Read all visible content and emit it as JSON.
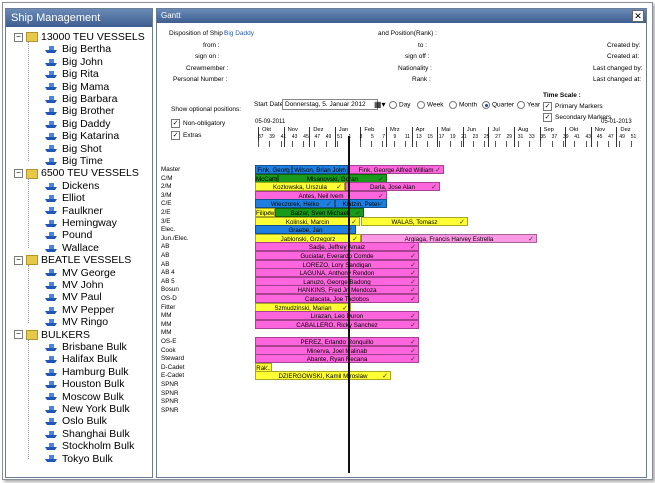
{
  "left_panel": {
    "title": "Ship Management",
    "groups": [
      {
        "label": "13000 TEU VESSELS",
        "items": [
          "Big Bertha",
          "Big John",
          "Big Rita",
          "Big  Mama",
          "Big Barbara",
          "Big Brother",
          "Big Daddy",
          "Big Katarina",
          "Big Shot",
          "Big Time"
        ]
      },
      {
        "label": "6500 TEU VESSELS",
        "items": [
          "Dickens",
          "Elliot",
          "Faulkner",
          "Hemingway",
          "Pound",
          "Wallace"
        ]
      },
      {
        "label": "BEATLE VESSELS",
        "items": [
          "MV George",
          "MV John",
          "MV Paul",
          "MV Pepper",
          "MV Ringo"
        ]
      },
      {
        "label": "BULKERS",
        "items": [
          "Brisbane Bulk",
          "Halifax Bulk",
          "Hamburg Bulk",
          "Houston Bulk",
          "Moscow Bulk",
          "New York Bulk",
          "Oslo Bulk",
          "Shanghai Bulk",
          "Stockholm Bulk",
          "Tokyo Bulk"
        ]
      }
    ]
  },
  "gantt": {
    "title": "Gantt",
    "info": {
      "disposition_label": "Disposition of Ship :",
      "disposition_value": "Big Daddy",
      "from_label": "from :",
      "signon_label": "sign on :",
      "crewmember_label": "Crewmember :",
      "personal_label": "Personal Number :",
      "position_label": "and Position(Rank) :",
      "to_label": "to :",
      "signoff_label": "sign off :",
      "nationality_label": "Nationality :",
      "rank_label": "Rank :",
      "created_by": "Created by:",
      "created_at": "Created at:",
      "last_changed_by": "Last changed by:",
      "last_changed_at": "Last changed at:"
    },
    "options": {
      "show_label": "Show optional positions:",
      "non_obligatory": "Non-obligatory",
      "extras": "Extras"
    },
    "controls": {
      "start_date_label": "Start Date:",
      "start_date_value": "Donnerstag,  5.  Januar  2012",
      "day": "Day",
      "week": "Week",
      "month": "Month",
      "quarter": "Quarter",
      "year": "Year",
      "selected_scale": "Quarter",
      "time_scale_label": "Time Scale :",
      "primary_markers": "Primary Markers",
      "secondary_markers": "Secondary Markers"
    },
    "axis": {
      "start_date": "05-09-2011",
      "end_date": "05-01-2013",
      "months": [
        "Okt",
        "Nov",
        "Dez",
        "Jan",
        "Feb",
        "Mrz",
        "Apr",
        "Mai",
        "Jun",
        "Jul",
        "Aug",
        "Sep",
        "Okt",
        "Nov",
        "Dez"
      ],
      "weeks": [
        "37",
        "39",
        "41",
        "43",
        "45",
        "47",
        "49",
        "51",
        "1",
        "3",
        "5",
        "7",
        "9",
        "11",
        "13",
        "15",
        "17",
        "19",
        "21",
        "23",
        "25",
        "27",
        "29",
        "31",
        "33",
        "35",
        "37",
        "39",
        "41",
        "43",
        "45",
        "47",
        "49",
        "51"
      ]
    },
    "rows": [
      {
        "role": "Master",
        "bars": [
          {
            "text": "Fink, Georg",
            "color": "#1e7fe0"
          },
          {
            "text": "Wilson, Brian John",
            "color": "#1e7fe0"
          },
          {
            "text": "Fink, George Alfred William",
            "color": "#ff66dd"
          }
        ]
      },
      {
        "role": "C/M",
        "bars": [
          {
            "text": "McCartr...",
            "color": "#1a9a1a"
          },
          {
            "text": "Mlsanovski, Goran",
            "color": "#1a9a1a"
          }
        ]
      },
      {
        "role": "2/M",
        "bars": [
          {
            "text": "Kozlowska, Urszula",
            "color": "#ffff33"
          },
          {
            "text": "Darla, Jose Alan",
            "color": "#ff66dd"
          }
        ]
      },
      {
        "role": "3/M",
        "bars": [
          {
            "text": "Antes, Neil Ivem",
            "color": "#ff66dd"
          }
        ]
      },
      {
        "role": "C/E",
        "bars": [
          {
            "text": "Wieczorek, Heiko",
            "color": "#1e7fe0"
          },
          {
            "text": "Klatzin, Peter",
            "color": "#1e7fe0"
          }
        ]
      },
      {
        "role": "2/E",
        "bars": [
          {
            "text": "Filipow...",
            "color": "#ffff33"
          },
          {
            "text": "Balzer, Sven Michael",
            "color": "#1a9a1a"
          }
        ]
      },
      {
        "role": "3/E",
        "bars": [
          {
            "text": "Kolinski, Marcin",
            "color": "#ffff33"
          },
          {
            "text": "WALAS, Tomasz",
            "color": "#ffff33"
          }
        ]
      },
      {
        "role": "Elec.",
        "bars": [
          {
            "text": "Graebe, Jan",
            "color": "#1e7fe0"
          }
        ]
      },
      {
        "role": "Jun./Elec.",
        "bars": [
          {
            "text": "Jablonski, Grzegorz",
            "color": "#ffff33"
          },
          {
            "text": "Argiaga, Francis Harvey Estrella",
            "color": "#ff99e6"
          }
        ]
      },
      {
        "role": "AB",
        "bars": [
          {
            "text": "Sadje, Jeffrey Amaiz",
            "color": "#ff66dd"
          }
        ]
      },
      {
        "role": "AB",
        "bars": [
          {
            "text": "Guciatar, Everardo Comde",
            "color": "#ff66dd"
          }
        ]
      },
      {
        "role": "AB",
        "bars": [
          {
            "text": "LOREZO, Lory Sandigan",
            "color": "#ff66dd"
          }
        ]
      },
      {
        "role": "AB 4",
        "bars": [
          {
            "text": "LAGUNA, Anthony Rendon",
            "color": "#ff66dd"
          }
        ]
      },
      {
        "role": "AB 5",
        "bars": [
          {
            "text": "Lanuzo, George Badong",
            "color": "#ff66dd"
          }
        ]
      },
      {
        "role": "Bosun",
        "bars": [
          {
            "text": "HANKINS, Fred Jr. Mendoza",
            "color": "#ff66dd"
          }
        ]
      },
      {
        "role": "OS-D",
        "bars": [
          {
            "text": "Catacata, Joe Taclobos",
            "color": "#ff66dd"
          }
        ]
      },
      {
        "role": "Fitter",
        "bars": [
          {
            "text": "Szmudzinski, Marian",
            "color": "#ffff33"
          }
        ]
      },
      {
        "role": "MM",
        "bars": [
          {
            "text": "Lirazan, Leo Duron",
            "color": "#ff66dd"
          }
        ]
      },
      {
        "role": "MM",
        "bars": [
          {
            "text": "CABALLERO, Ricky Sanchez",
            "color": "#ff66dd"
          }
        ]
      },
      {
        "role": "MM",
        "bars": []
      },
      {
        "role": "OS-E",
        "bars": [
          {
            "text": "PEREZ, Erlando Ronquillo",
            "color": "#ff66dd"
          }
        ]
      },
      {
        "role": "Cook",
        "bars": [
          {
            "text": "Minerva, Joel Malinab",
            "color": "#ff66dd"
          }
        ]
      },
      {
        "role": "Steward",
        "bars": [
          {
            "text": "Abante, Ryan Recana",
            "color": "#ff66dd"
          }
        ]
      },
      {
        "role": "D-Cadet",
        "bars": [
          {
            "text": "Ral...",
            "color": "#ffff33"
          }
        ]
      },
      {
        "role": "E-Cadet",
        "bars": [
          {
            "text": "DZIERGOWSKI, Kamil Miroslaw",
            "color": "#ffff33"
          }
        ]
      },
      {
        "role": "SPNR",
        "bars": []
      },
      {
        "role": "SPNR",
        "bars": []
      },
      {
        "role": "SPNR",
        "bars": []
      },
      {
        "role": "SPNR",
        "bars": []
      }
    ]
  }
}
